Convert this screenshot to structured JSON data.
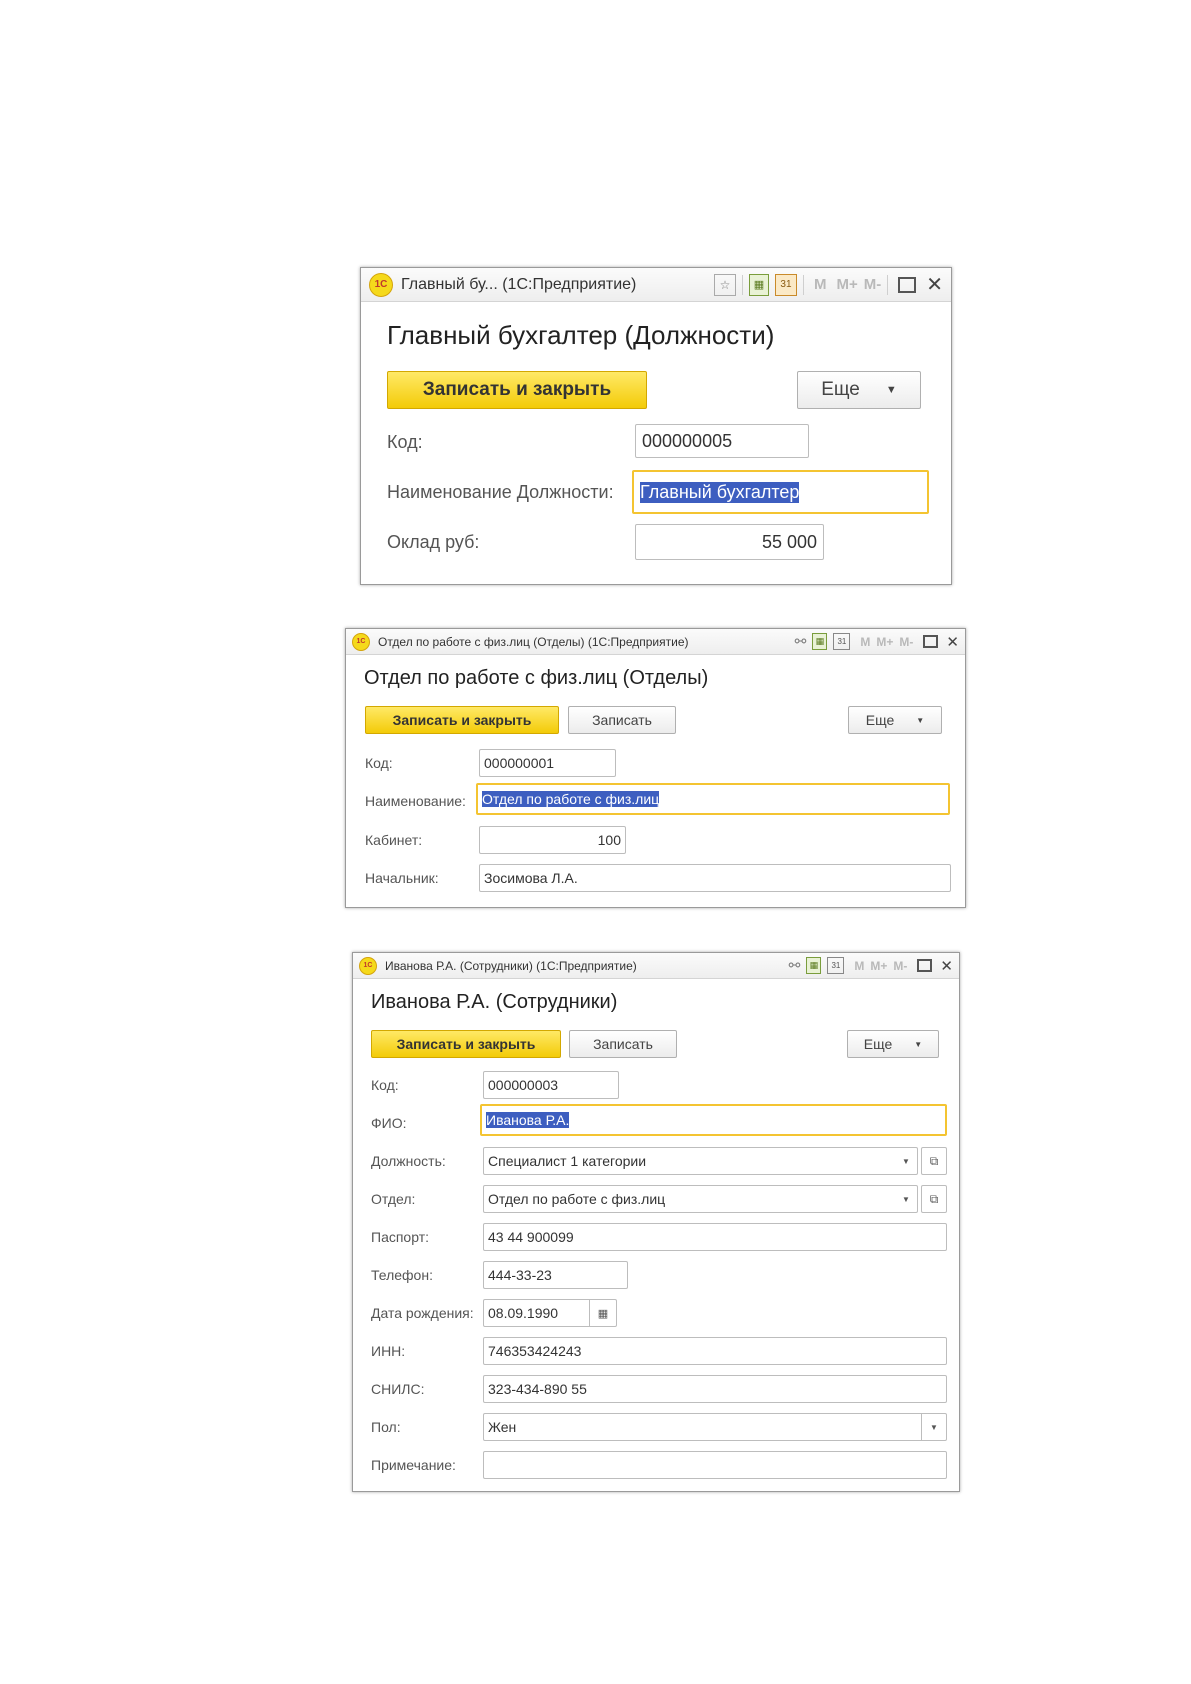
{
  "window1": {
    "window_title": "Главный бу... (1С:Предприятие)",
    "logo_text": "1С",
    "toolbar_icons": [
      "star-icon",
      "calculator-icon",
      "calendar-icon"
    ],
    "memory": {
      "m": "M",
      "m_plus": "M+",
      "m_minus": "M-"
    },
    "form_title": "Главный бухгалтер (Должности)",
    "save_close_label": "Записать и закрыть",
    "more_label": "Еще",
    "code_label": "Код:",
    "code_value": "000000005",
    "name_label": "Наименование Должности:",
    "name_value": "Главный бухгалтер",
    "salary_label": "Оклад руб:",
    "salary_value": "55 000"
  },
  "window2": {
    "window_title": "Отдел по работе с физ.лиц (Отделы) (1С:Предприятие)",
    "logo_text": "1С",
    "toolbar_icons": [
      "link-icon",
      "calculator-icon",
      "calendar-icon"
    ],
    "memory": {
      "m": "M",
      "m_plus": "M+",
      "m_minus": "M-"
    },
    "form_title": "Отдел по работе с физ.лиц (Отделы)",
    "save_close_label": "Записать и закрыть",
    "save_label": "Записать",
    "more_label": "Еще",
    "code_label": "Код:",
    "code_value": "000000001",
    "name_label": "Наименование:",
    "name_value": "Отдел по работе с физ.лиц",
    "cabinet_label": "Кабинет:",
    "cabinet_value": "100",
    "head_label": "Начальник:",
    "head_value": "Зосимова Л.А."
  },
  "window3": {
    "window_title": "Иванова Р.А. (Сотрудники) (1С:Предприятие)",
    "logo_text": "1С",
    "toolbar_icons": [
      "link-icon",
      "calculator-icon",
      "calendar-icon"
    ],
    "memory": {
      "m": "M",
      "m_plus": "M+",
      "m_minus": "M-"
    },
    "form_title": "Иванова Р.А. (Сотрудники)",
    "save_close_label": "Записать и закрыть",
    "save_label": "Записать",
    "more_label": "Еще",
    "code_label": "Код:",
    "code_value": "000000003",
    "fio_label": "ФИО:",
    "fio_value": "Иванова Р.А.",
    "position_label": "Должность:",
    "position_value": "Специалист 1 категории",
    "dept_label": "Отдел:",
    "dept_value": "Отдел по работе с физ.лиц",
    "passport_label": "Паспорт:",
    "passport_value": "43 44 900099",
    "phone_label": "Телефон:",
    "phone_value": "444-33-23",
    "birth_label": "Дата рождения:",
    "birth_value": "08.09.1990",
    "inn_label": "ИНН:",
    "inn_value": "746353424243",
    "snils_label": "СНИЛС:",
    "snils_value": "323-434-890 55",
    "gender_label": "Пол:",
    "gender_value": "Жен",
    "note_label": "Примечание:",
    "note_value": ""
  }
}
